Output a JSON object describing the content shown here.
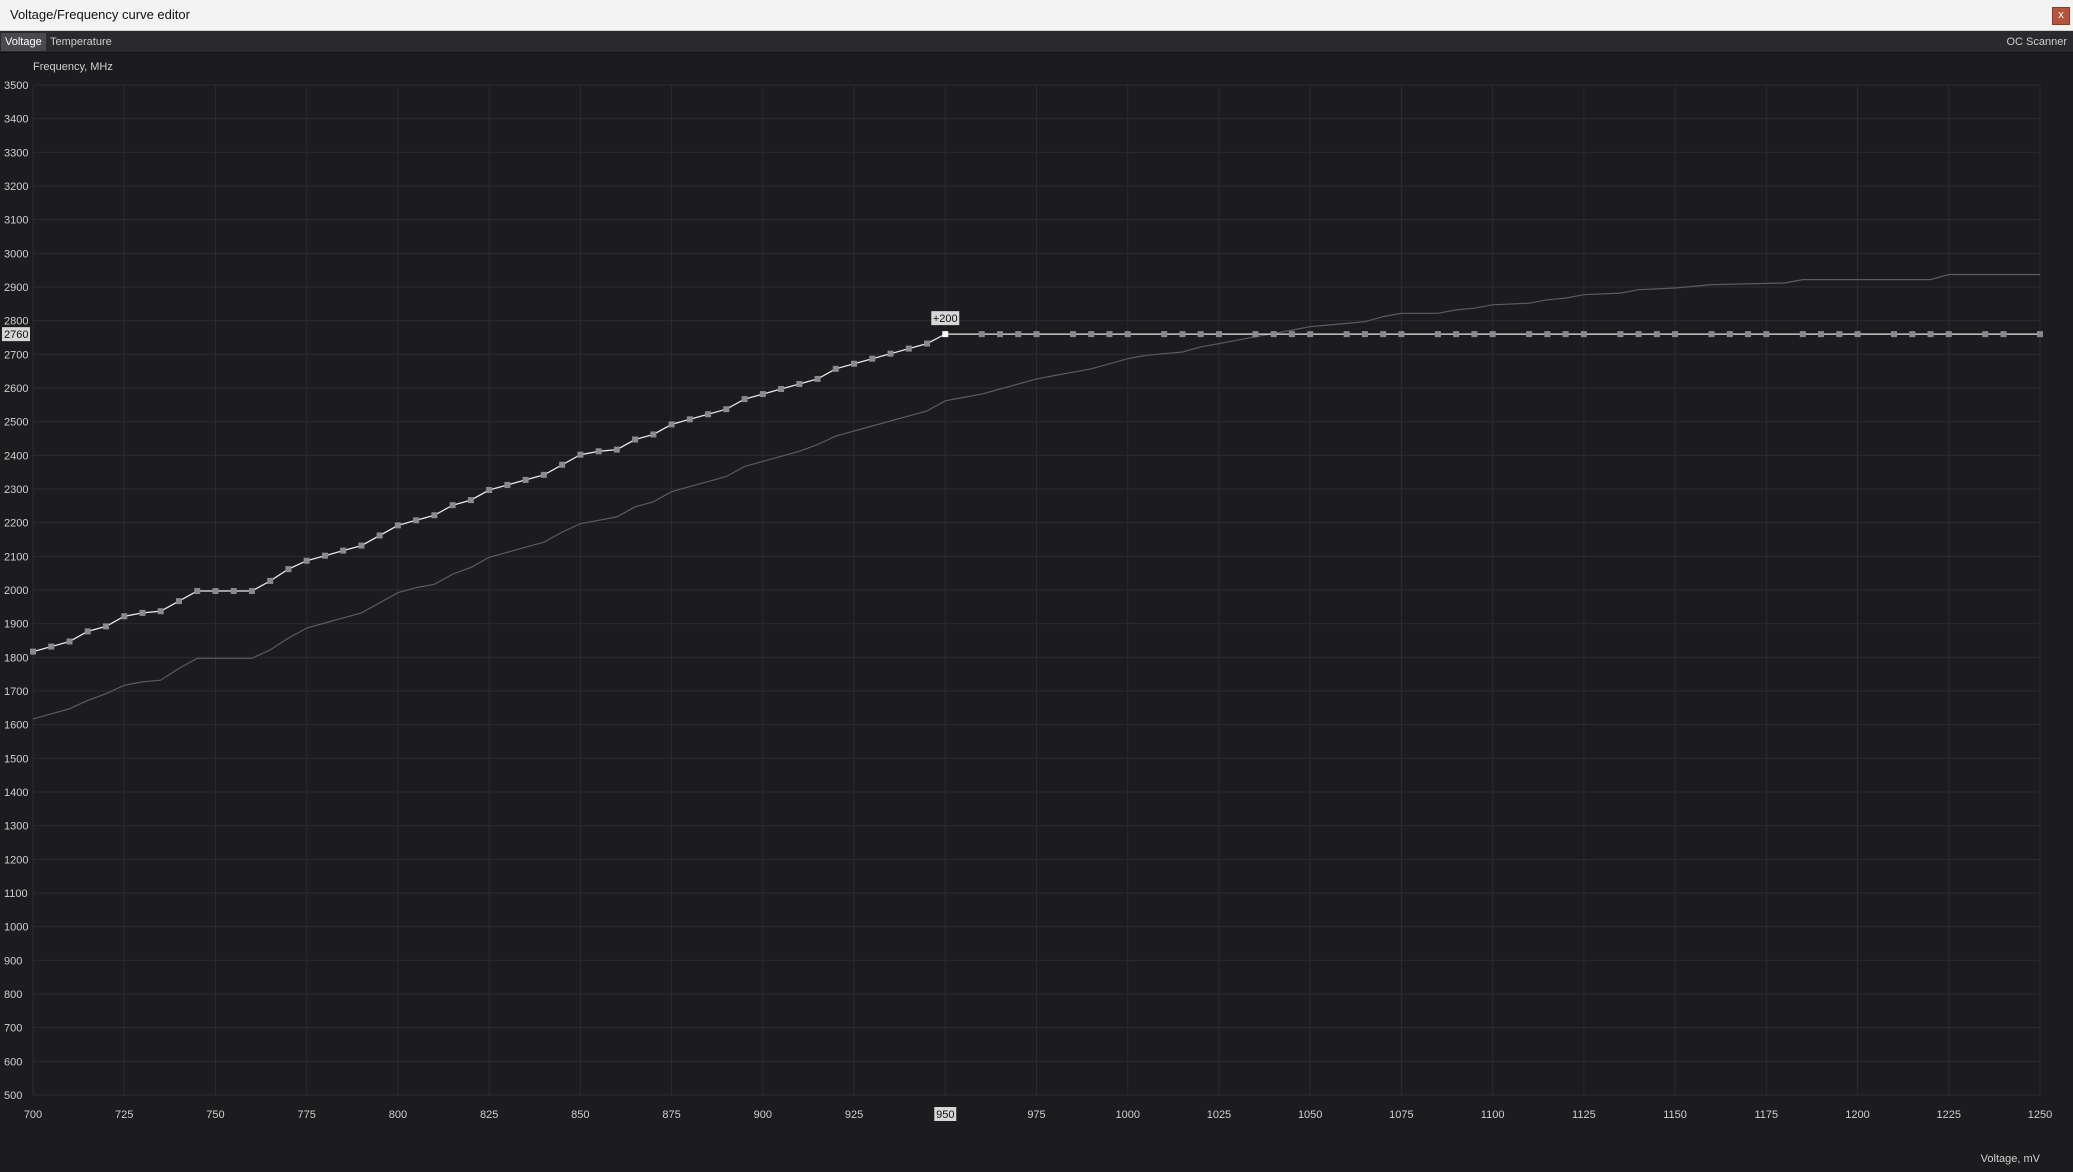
{
  "window": {
    "title": "Voltage/Frequency curve editor",
    "close_label": "x"
  },
  "tabs": [
    {
      "label": "Voltage",
      "active": true
    },
    {
      "label": "Temperature",
      "active": false
    }
  ],
  "oc_scanner_label": "OC Scanner",
  "colors": {
    "background": "#1c1c1f",
    "grid": "#2b2b2e",
    "curve": "#e6e6e6",
    "baseline": "#5c5c60",
    "point": "#8a8a8e",
    "selected_point": "#ffffff",
    "highlight_label_bg": "#d6d6d6"
  },
  "chart_data": {
    "type": "line",
    "title": "",
    "xlabel": "Voltage, mV",
    "ylabel": "Frequency, MHz",
    "xlim": [
      700,
      1250
    ],
    "ylim": [
      500,
      3500
    ],
    "x_ticks": [
      700,
      725,
      750,
      775,
      800,
      825,
      850,
      875,
      900,
      925,
      950,
      975,
      1000,
      1025,
      1050,
      1075,
      1100,
      1125,
      1150,
      1175,
      1200,
      1225,
      1250
    ],
    "y_ticks": [
      500,
      600,
      700,
      800,
      900,
      1000,
      1100,
      1200,
      1300,
      1400,
      1500,
      1600,
      1700,
      1800,
      1900,
      2000,
      2100,
      2200,
      2300,
      2400,
      2500,
      2600,
      2700,
      2800,
      2900,
      3000,
      3100,
      3200,
      3300,
      3400,
      3500
    ],
    "grid": true,
    "series": [
      {
        "role": "baseline",
        "x": [
          700,
          710,
          715,
          720,
          725,
          730,
          735,
          740,
          745,
          750,
          755,
          760,
          765,
          770,
          775,
          780,
          785,
          790,
          795,
          800,
          805,
          810,
          815,
          820,
          825,
          830,
          835,
          840,
          845,
          850,
          855,
          860,
          865,
          870,
          875,
          880,
          885,
          890,
          895,
          900,
          905,
          910,
          915,
          920,
          925,
          930,
          935,
          940,
          945,
          950,
          955,
          960,
          965,
          970,
          975,
          980,
          985,
          990,
          995,
          1000,
          1005,
          1010,
          1015,
          1020,
          1025,
          1030,
          1035,
          1040,
          1045,
          1050,
          1055,
          1060,
          1065,
          1070,
          1075,
          1085,
          1090,
          1095,
          1100,
          1110,
          1115,
          1120,
          1125,
          1135,
          1140,
          1150,
          1160,
          1180,
          1185,
          1220,
          1225,
          1250
        ],
        "values": [
          1617,
          1647,
          1672,
          1692,
          1717,
          1727,
          1732,
          1767,
          1797,
          1797,
          1797,
          1797,
          1822,
          1857,
          1887,
          1902,
          1917,
          1932,
          1962,
          1992,
          2007,
          2017,
          2047,
          2067,
          2097,
          2112,
          2127,
          2142,
          2172,
          2197,
          2207,
          2217,
          2247,
          2262,
          2292,
          2307,
          2322,
          2337,
          2367,
          2382,
          2397,
          2412,
          2432,
          2457,
          2472,
          2487,
          2502,
          2517,
          2532,
          2562,
          2572,
          2582,
          2597,
          2612,
          2627,
          2637,
          2647,
          2657,
          2672,
          2687,
          2697,
          2702,
          2707,
          2722,
          2732,
          2742,
          2752,
          2762,
          2772,
          2782,
          2787,
          2792,
          2797,
          2812,
          2822,
          2822,
          2832,
          2837,
          2847,
          2852,
          2862,
          2867,
          2877,
          2882,
          2892,
          2897,
          2907,
          2912,
          2922,
          2922,
          2937,
          2937
        ]
      },
      {
        "role": "curve",
        "x": [
          700,
          705,
          710,
          715,
          720,
          725,
          730,
          735,
          740,
          745,
          750,
          755,
          760,
          765,
          770,
          775,
          780,
          785,
          790,
          795,
          800,
          805,
          810,
          815,
          820,
          825,
          830,
          835,
          840,
          845,
          850,
          855,
          860,
          865,
          870,
          875,
          880,
          885,
          890,
          895,
          900,
          905,
          910,
          915,
          920,
          925,
          930,
          935,
          940,
          945,
          950,
          960,
          965,
          970,
          975,
          985,
          990,
          995,
          1000,
          1010,
          1015,
          1020,
          1025,
          1035,
          1040,
          1045,
          1050,
          1060,
          1065,
          1070,
          1075,
          1085,
          1090,
          1095,
          1100,
          1110,
          1115,
          1120,
          1125,
          1135,
          1140,
          1145,
          1150,
          1160,
          1165,
          1170,
          1175,
          1185,
          1190,
          1195,
          1200,
          1210,
          1215,
          1220,
          1225,
          1235,
          1240,
          1250
        ],
        "values": [
          1817,
          1832,
          1847,
          1877,
          1892,
          1922,
          1932,
          1937,
          1967,
          1997,
          1997,
          1997,
          1997,
          2027,
          2062,
          2087,
          2102,
          2117,
          2132,
          2162,
          2192,
          2207,
          2222,
          2252,
          2267,
          2297,
          2312,
          2327,
          2342,
          2372,
          2402,
          2412,
          2417,
          2447,
          2462,
          2492,
          2507,
          2522,
          2537,
          2567,
          2582,
          2597,
          2612,
          2627,
          2657,
          2672,
          2687,
          2702,
          2717,
          2732,
          2760,
          2760,
          2760,
          2760,
          2760,
          2760,
          2760,
          2760,
          2760,
          2760,
          2760,
          2760,
          2760,
          2760,
          2760,
          2760,
          2760,
          2760,
          2760,
          2760,
          2760,
          2760,
          2760,
          2760,
          2760,
          2760,
          2760,
          2760,
          2760,
          2760,
          2760,
          2760,
          2760,
          2760,
          2760,
          2760,
          2760,
          2760,
          2760,
          2760,
          2760,
          2760,
          2760,
          2760,
          2760,
          2760,
          2760,
          2760
        ],
        "point_count": 97
      }
    ],
    "selected_point": {
      "x": 950,
      "y": 2760,
      "offset_label": "+200",
      "x_label": "950",
      "y_label": "2760"
    },
    "legend": "none"
  }
}
